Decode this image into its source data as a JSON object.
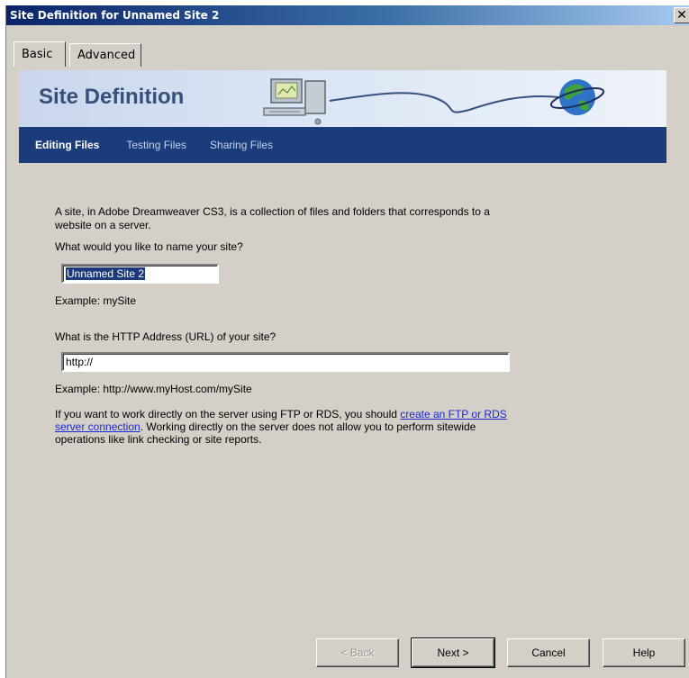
{
  "window": {
    "title": "Site Definition for Unnamed Site 2",
    "close_glyph": "✕"
  },
  "tabs": [
    {
      "label": "Basic",
      "active": true
    },
    {
      "label": "Advanced",
      "active": false
    }
  ],
  "banner": {
    "title": "Site Definition",
    "icons": [
      "computer-icon",
      "globe-icon"
    ]
  },
  "nav": {
    "items": [
      {
        "label": "Editing Files",
        "active": true
      },
      {
        "label": "Testing Files",
        "active": false
      },
      {
        "label": "Sharing Files",
        "active": false
      }
    ]
  },
  "content": {
    "intro_line1": "A site, in Adobe Dreamweaver CS3, is a collection of files and folders that corresponds to a",
    "intro_line2": "website on a server.",
    "name_question": "What would you like to name your site?",
    "name_value": "Unnamed Site 2",
    "name_example": "Example: mySite",
    "url_question": "What is the HTTP Address (URL) of your site?",
    "url_value": "http://",
    "url_example": "Example: http://www.myHost.com/mySite",
    "ftp_text_before": "If you want to work directly on the server using FTP or RDS, you should ",
    "ftp_link_part1": "create an FTP or RDS",
    "ftp_link_part2": "server connection",
    "ftp_text_after": ".  Working directly on the server does not allow you to perform sitewide",
    "ftp_text_line3": "operations like link checking or site reports."
  },
  "buttons": {
    "back": "< Back",
    "next": "Next >",
    "cancel": "Cancel",
    "help": "Help"
  },
  "colors": {
    "titlebar": "#0a246a",
    "nav_bar": "#1a3c7b",
    "banner_title": "#36507a",
    "link": "#1a28d6",
    "dialog_bg": "#d4d0c8"
  }
}
